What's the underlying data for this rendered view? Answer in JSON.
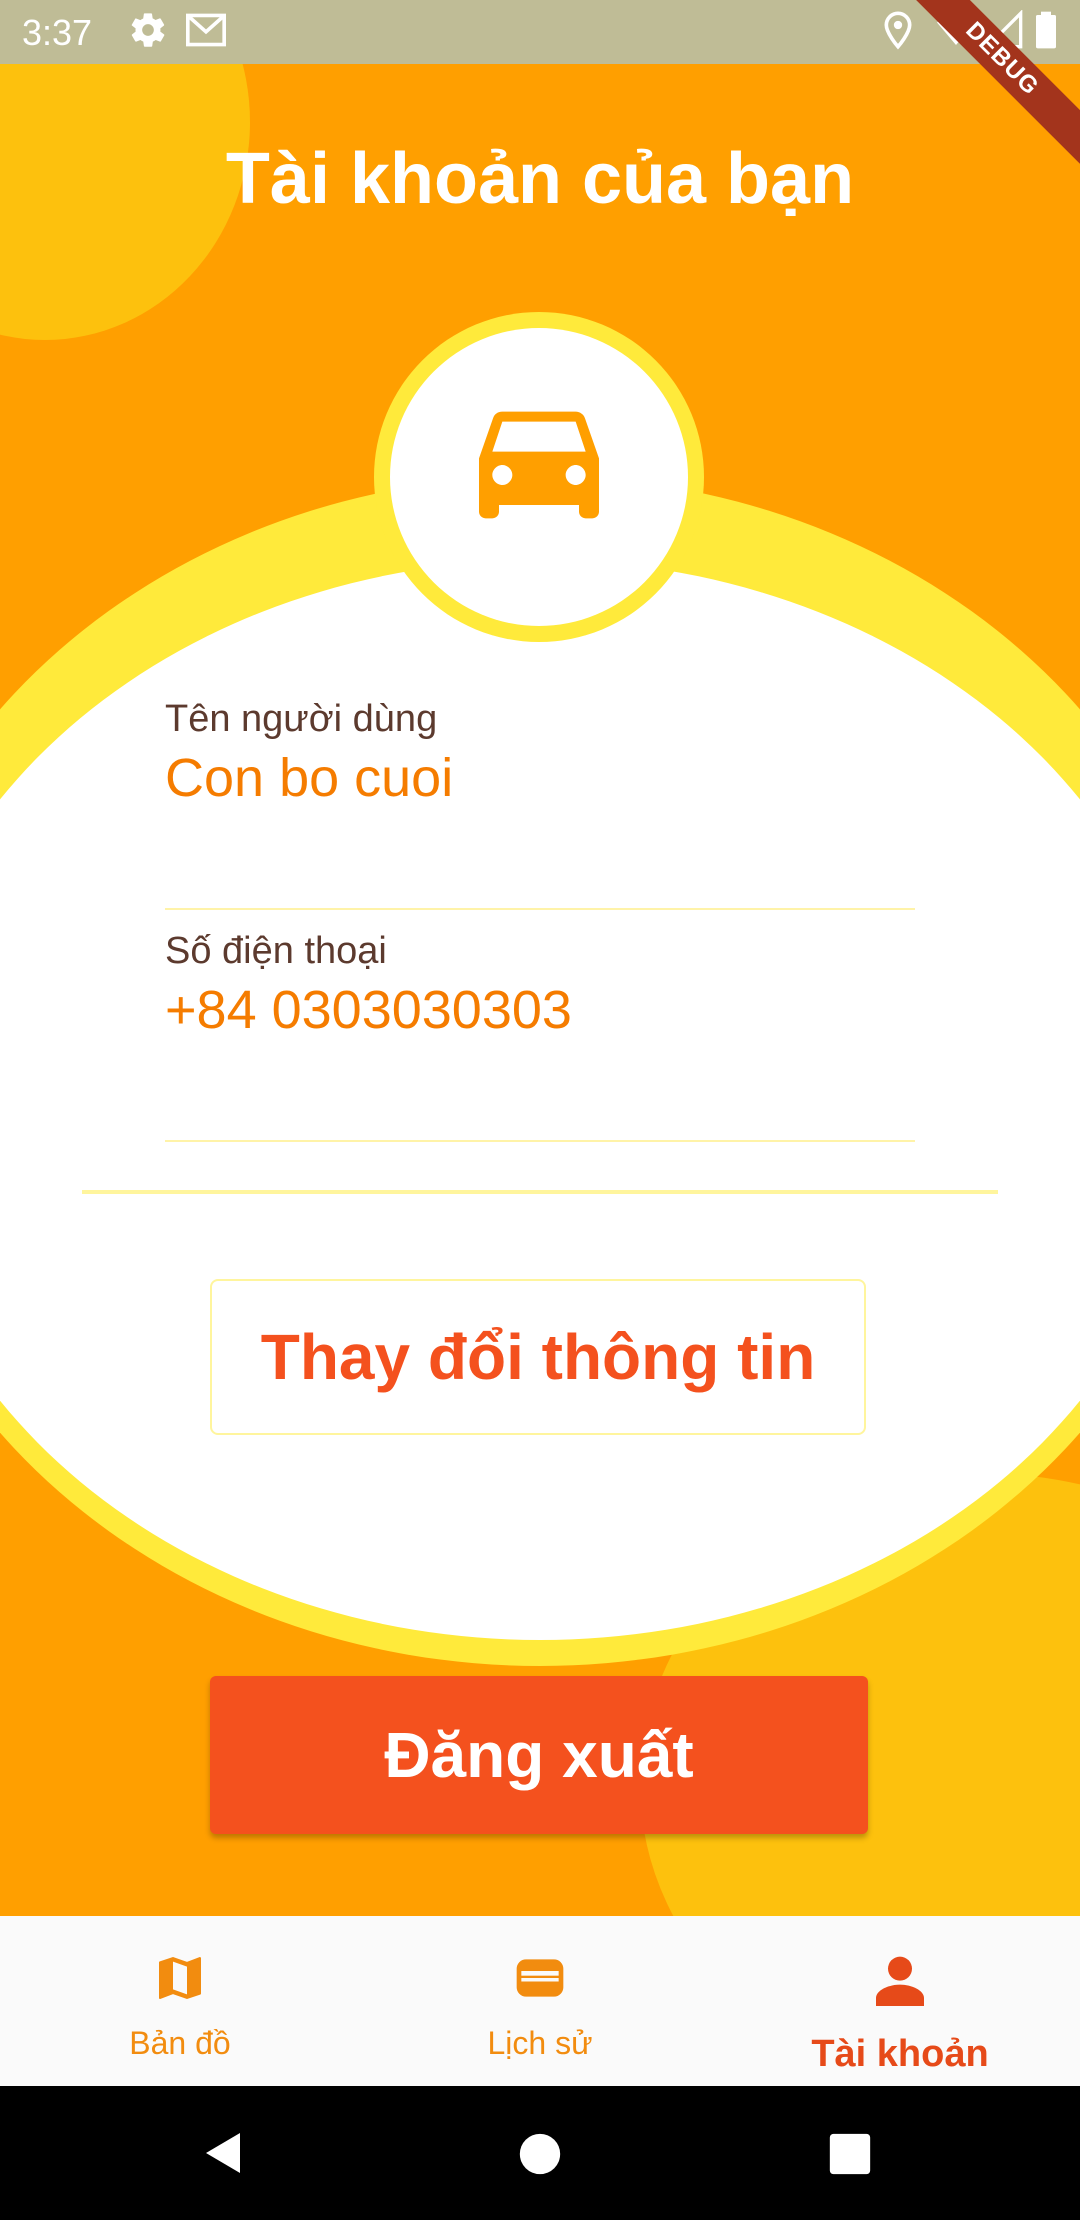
{
  "status_bar": {
    "time": "3:37",
    "debug_label": "DEBUG",
    "icons": [
      "gear-icon",
      "mail-icon",
      "location-icon",
      "wifi-icon",
      "signal-icon",
      "battery-icon"
    ]
  },
  "header": {
    "title": "Tài khoản của bạn"
  },
  "avatar": {
    "icon": "car-icon"
  },
  "profile": {
    "username_label": "Tên người dùng",
    "username_value": "Con bo cuoi",
    "phone_label": "Số điện thoại",
    "phone_value": "+84 0303030303"
  },
  "actions": {
    "edit_label": "Thay đổi thông tin",
    "logout_label": "Đăng xuất"
  },
  "bottom_nav": {
    "items": [
      {
        "label": "Bản đồ",
        "icon": "map-icon",
        "active": false
      },
      {
        "label": "Lịch sử",
        "icon": "wallet-icon",
        "active": false
      },
      {
        "label": "Tài khoản",
        "icon": "person-icon",
        "active": true
      }
    ]
  },
  "system_nav": {
    "icons": [
      "back-icon",
      "home-icon",
      "recents-icon"
    ]
  },
  "colors": {
    "background": "#FF9F00",
    "accent_yellow": "#FFEA3B",
    "value_orange": "#F57C00",
    "button_red": "#F4511E",
    "active_nav": "#E64A19"
  }
}
